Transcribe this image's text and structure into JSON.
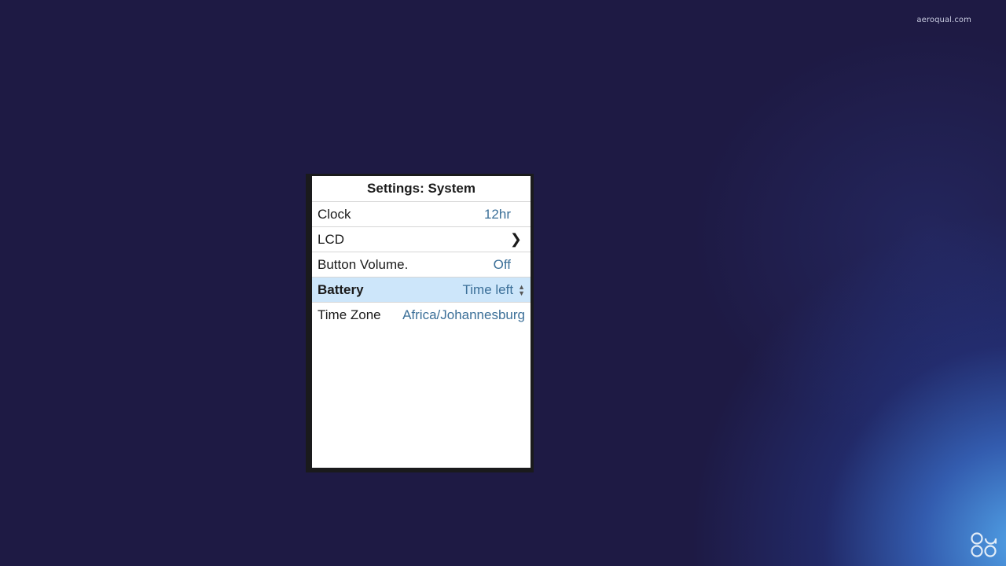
{
  "watermark": "aeroqual.com",
  "screen": {
    "title": "Settings: System",
    "rows": [
      {
        "label": "Clock",
        "value": "12hr"
      },
      {
        "label": "LCD",
        "value": ""
      },
      {
        "label": "Button Volume.",
        "value": "Off"
      },
      {
        "label": "Battery",
        "value": "Time left",
        "selected": true
      },
      {
        "label": "Time Zone",
        "value": "Africa/Johannesburg"
      }
    ]
  },
  "icons": {
    "lcd": "chevron-right-icon",
    "battery": "up-down-arrows-icon",
    "brand": "aeroqual-logo"
  },
  "colors": {
    "background": "#1e1a44",
    "selected_row": "#cde6fa",
    "value_text": "#3b6f98"
  }
}
